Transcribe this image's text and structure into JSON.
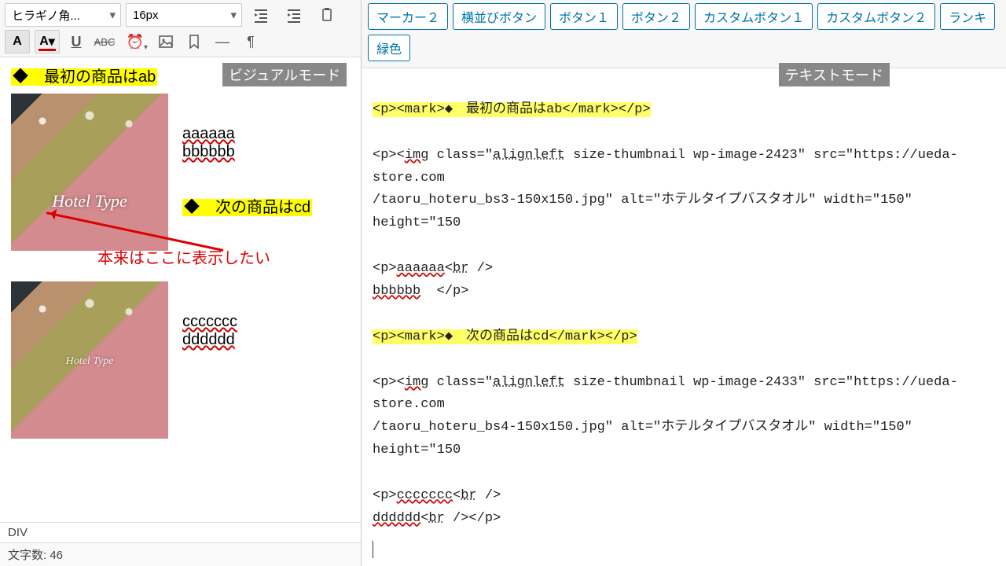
{
  "toolbar": {
    "font": "ヒラギノ角...",
    "size": "16px"
  },
  "mode_labels": {
    "visual": "ビジュアルモード",
    "text": "テキストモード"
  },
  "visual": {
    "mark1": "◆　最初の商品はab",
    "aaa": "aaaaaa",
    "bbb": "bbbbbb",
    "mark2": "◆　次の商品はcd",
    "ccc": "ccccccc",
    "ddd": "dddddd",
    "thumb_label": "Hotel Type"
  },
  "annotation": "本来はここに表示したい",
  "status": {
    "path": "DIV",
    "chars": "文字数: 46"
  },
  "right_buttons": [
    "マーカー２",
    "横並びボタン",
    "ボタン１",
    "ボタン２",
    "カスタムボタン１",
    "カスタムボタン２",
    "ランキ",
    "緑色"
  ],
  "code": {
    "l1": "<p><mark>◆　最初の商品はab</mark></p>",
    "l2a": "<p><",
    "l2_img": "img",
    "l2b": " class=\"",
    "l2_align": "alignleft",
    "l2c": " size-thumbnail wp-image-2423\" src=\"https://ueda-store.com",
    "l3": "/taoru_hoteru_bs3-150x150.jpg\" alt=\"ホテルタイプバスタオル\" width=\"150\" height=\"150",
    "l4a": "<p>",
    "l4_aaa": "aaaaaa",
    "l4b": "<",
    "l4_br": "br",
    "l4c": " />",
    "l5_bbb": "bbbbbb",
    "l5b": "  </p>",
    "l6": "<p><mark>◆　次の商品はcd</mark></p>",
    "l7a": "<p><",
    "l7_img": "img",
    "l7b": " class=\"",
    "l7_align": "alignleft",
    "l7c": " size-thumbnail wp-image-2433\" src=\"https://ueda-store.com",
    "l8": "/taoru_hoteru_bs4-150x150.jpg\" alt=\"ホテルタイプバスタオル\" width=\"150\" height=\"150",
    "l9a": "<p>",
    "l9_ccc": "ccccccc",
    "l9b": "<",
    "l9_br": "br",
    "l9c": " />",
    "l10_ddd": "dddddd",
    "l10b": "<",
    "l10_br": "br",
    "l10c": " /></p>"
  }
}
